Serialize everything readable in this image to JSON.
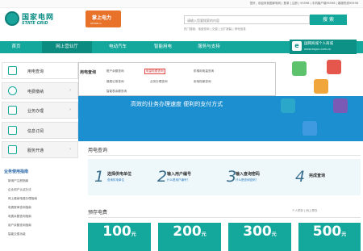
{
  "topbar": {
    "right": "您好，欢迎来到国家电网 | 登录 | 注册 | 95598 | 手机客户端95598 | 客服热线95598"
  },
  "logo": {
    "cn": "国家电网",
    "en": "STATE GRID"
  },
  "promo": {
    "title": "掌上电力",
    "sub": "95598.cn"
  },
  "search": {
    "placeholder": "请输入您要搜索的内容",
    "button": "搜 索",
    "hot": "热门搜索：电费查询 | 交费 | 业扩报装 | 停电信息"
  },
  "nav": {
    "items": [
      "首页",
      "网上营业厅",
      "电动汽车",
      "智能用电",
      "服务与支持"
    ]
  },
  "mall": {
    "title": "国网商城个人商城",
    "sub": "www.esgcc.com.cn"
  },
  "sidebar": {
    "items": [
      {
        "label": "用电查询",
        "icon": "magnifier-icon"
      },
      {
        "label": "电费缴纳",
        "icon": "coin-icon"
      },
      {
        "label": "业务办理",
        "icon": "wrench-icon"
      },
      {
        "label": "信息订阅",
        "icon": "lightning-icon"
      },
      {
        "label": "服务开通",
        "icon": "edit-icon"
      }
    ]
  },
  "dropdown": {
    "head": "用电查询",
    "links": [
      "账户余额查询",
      "电量电费查询",
      "阶梯用电量查询",
      "缴费记录查询",
      "业务办理查询",
      "用电档案查询",
      "智能表余额查询"
    ]
  },
  "banner": {
    "text": "高效的业务办理速度  便利的支付方式"
  },
  "query": {
    "title": "用电查询"
  },
  "steps": [
    {
      "num": "1",
      "title": "选择供电单位",
      "sub": "查询供电单位"
    },
    {
      "num": "2",
      "title": "输入用户编号",
      "sub": "什么是用户编号？"
    },
    {
      "num": "3",
      "title": "输入查询密码",
      "sub": "什么是查询密码？"
    },
    {
      "num": "4",
      "title": "完成查询",
      "sub": ""
    }
  ],
  "guide": {
    "title": "业务使用指南",
    "items": [
      "新用户注册指南",
      "企业用户认证办法",
      "网上缴纳电费办理指南",
      "电费账单查询指南",
      "电费余额查询指南",
      "用户余额查询指南",
      "智能交费功能"
    ]
  },
  "fees": {
    "title": "预存电费",
    "links": "个人预存 | 网上预存",
    "cards": [
      {
        "amount": "100",
        "unit": "元"
      },
      {
        "amount": "200",
        "unit": "元"
      },
      {
        "amount": "300",
        "unit": "元"
      },
      {
        "amount": "500",
        "unit": "元"
      }
    ]
  }
}
